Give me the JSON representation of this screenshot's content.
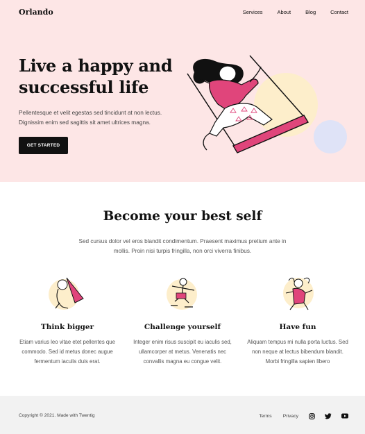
{
  "header": {
    "site_title": "Orlando",
    "nav": [
      "Services",
      "About",
      "Blog",
      "Contact"
    ]
  },
  "hero": {
    "title": "Live a happy and successful life",
    "text": "Pellentesque et velit egestas sed tincidunt at non lectus. Dignissim enim sed sagittis sit amet ultrices magna.",
    "button_label": "GET STARTED"
  },
  "section": {
    "title": "Become your best self",
    "text": "Sed cursus dolor vel eros blandit condimentum. Praesent maximus pretium ante in mollis. Proin nisi turpis fringilla, non orci viverra finibus."
  },
  "features": [
    {
      "title": "Think bigger",
      "text": "Etiam varius leo vitae etet pellentes que commodo. Sed id metus donec augue fermentum iaculis duis erat."
    },
    {
      "title": "Challenge yourself",
      "text": "Integer enim risus suscipit eu iaculis sed, ullamcorper at metus. Venenatis nec convallis magna eu congue velit."
    },
    {
      "title": "Have fun",
      "text": "Aliquam tempus mi nulla porta luctus. Sed non neque at lectus bibendum blandit. Morbi fringilla sapien libero"
    }
  ],
  "footer": {
    "copyright": "Copyright © 2021. Made with Twentig",
    "links": [
      "Terms",
      "Privacy"
    ],
    "social_icons": [
      "instagram-icon",
      "twitter-icon",
      "youtube-icon"
    ]
  },
  "colors": {
    "hero_bg": "#fde6e6",
    "accent_pink": "#e0457b",
    "accent_yellow": "#fdeecb",
    "accent_blue": "#dfe3f7",
    "footer_bg": "#f2f2f2",
    "button_bg": "#111111"
  }
}
